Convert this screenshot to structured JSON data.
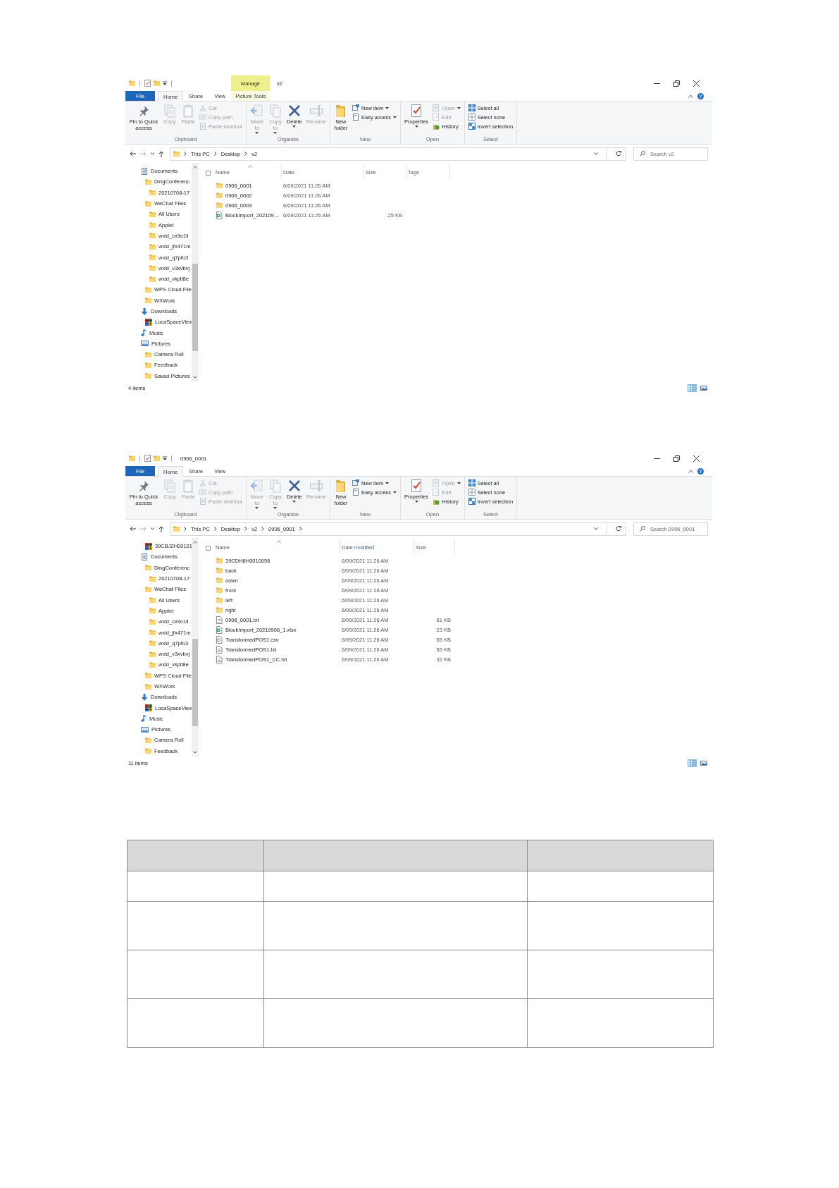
{
  "windows": [
    {
      "title": "v2",
      "context_header": "Manage",
      "help": "?",
      "ribbon_tabs": [
        {
          "label": "File",
          "kind": "file",
          "selected": false
        },
        {
          "label": "Home",
          "kind": "tab",
          "selected": true
        },
        {
          "label": "Share",
          "kind": "tab",
          "selected": false
        },
        {
          "label": "View",
          "kind": "tab",
          "selected": false
        },
        {
          "label": "Picture Tools",
          "kind": "context",
          "selected": false
        }
      ],
      "ribbon_groups": [
        {
          "label": "Clipboard",
          "commands": [
            {
              "label": "Pin to Quick access",
              "kind": "large",
              "disabled": false,
              "menu": false
            },
            {
              "label": "Copy",
              "kind": "large",
              "disabled": true,
              "menu": false
            },
            {
              "label": "Paste",
              "kind": "large",
              "disabled": true,
              "menu": false
            },
            {
              "label": "Cut",
              "kind": "small",
              "disabled": true,
              "menu": false
            },
            {
              "label": "Copy path",
              "kind": "small",
              "disabled": true,
              "menu": false
            },
            {
              "label": "Paste shortcut",
              "kind": "small",
              "disabled": true,
              "menu": false
            }
          ]
        },
        {
          "label": "Organise",
          "commands": [
            {
              "label": "Move to",
              "kind": "large",
              "disabled": true,
              "menu": true
            },
            {
              "label": "Copy to",
              "kind": "large",
              "disabled": true,
              "menu": true
            },
            {
              "label": "Delete",
              "kind": "large",
              "disabled": false,
              "menu": true
            },
            {
              "label": "Rename",
              "kind": "large",
              "disabled": true,
              "menu": false
            }
          ]
        },
        {
          "label": "New",
          "commands": [
            {
              "label": "New folder",
              "kind": "large",
              "disabled": false,
              "menu": false
            },
            {
              "label": "New item",
              "kind": "small",
              "disabled": false,
              "menu": true
            },
            {
              "label": "Easy access",
              "kind": "small",
              "disabled": false,
              "menu": true
            }
          ]
        },
        {
          "label": "Open",
          "commands": [
            {
              "label": "Properties",
              "kind": "large",
              "disabled": false,
              "menu": true
            },
            {
              "label": "Open",
              "kind": "small",
              "disabled": true,
              "menu": true
            },
            {
              "label": "Edit",
              "kind": "small",
              "disabled": true,
              "menu": false
            },
            {
              "label": "History",
              "kind": "small",
              "disabled": false,
              "menu": false
            }
          ]
        },
        {
          "label": "Select",
          "commands": [
            {
              "label": "Select all",
              "kind": "small",
              "disabled": false,
              "menu": false
            },
            {
              "label": "Select none",
              "kind": "small",
              "disabled": false,
              "menu": false
            },
            {
              "label": "Invert selection",
              "kind": "small",
              "disabled": false,
              "menu": false
            }
          ]
        }
      ],
      "address": {
        "crumbs": [
          "This PC",
          "Desktop",
          "v2"
        ],
        "trailing_chevron": false
      },
      "search": {
        "placeholder": "Search v2"
      },
      "nav": [
        {
          "label": "Documents",
          "kind": "documents",
          "children": [
            {
              "label": "DingConferenc",
              "kind": "folder",
              "children": [
                {
                  "label": "20210708-17",
                  "kind": "folder"
                }
              ]
            },
            {
              "label": "WeChat Files",
              "kind": "folder",
              "children": [
                {
                  "label": "All Users",
                  "kind": "folder"
                },
                {
                  "label": "Applet",
                  "kind": "folder"
                },
                {
                  "label": "wxid_cx9o1il",
                  "kind": "folder"
                },
                {
                  "label": "wxid_jfx471m",
                  "kind": "folder"
                },
                {
                  "label": "wxid_q7pfo3",
                  "kind": "folder"
                },
                {
                  "label": "wxid_v3xvbvj",
                  "kind": "folder"
                },
                {
                  "label": "wxid_vkplt8e",
                  "kind": "folder"
                }
              ]
            },
            {
              "label": "WPS Cloud File",
              "kind": "folder"
            },
            {
              "label": "WXWork",
              "kind": "folder"
            }
          ]
        },
        {
          "label": "Downloads",
          "kind": "downloads",
          "children": [
            {
              "label": "LocaSpaceView",
              "kind": "app"
            }
          ]
        },
        {
          "label": "Music",
          "kind": "music"
        },
        {
          "label": "Pictures",
          "kind": "pictures",
          "children": [
            {
              "label": "Camera Roll",
              "kind": "folder"
            },
            {
              "label": "Feedback",
              "kind": "folder"
            },
            {
              "label": "Saved Pictures",
              "kind": "folder"
            }
          ]
        }
      ],
      "select_all": {
        "checked": false
      },
      "columns": [
        {
          "label": "Name",
          "sorted": true
        },
        {
          "label": "Date",
          "sorted": false
        },
        {
          "label": "Size",
          "sorted": false
        },
        {
          "label": "Tags",
          "sorted": false
        }
      ],
      "files": [
        {
          "name": "0906_0001",
          "kind": "folder",
          "date": "6/09/2021 11:26 AM"
        },
        {
          "name": "0906_0002",
          "kind": "folder",
          "date": "6/09/2021 11:26 AM"
        },
        {
          "name": "0906_0003",
          "kind": "folder",
          "date": "6/09/2021 11:26 AM"
        },
        {
          "name": "BlockImport_202109…",
          "kind": "excel",
          "date": "6/09/2021 11:26 AM",
          "size": "25 KB"
        }
      ],
      "status": "4 items",
      "view_buttons": [
        {
          "selected": true
        },
        {
          "selected": false
        }
      ]
    },
    {
      "title": "0906_0001",
      "help": "?",
      "ribbon_tabs": [
        {
          "label": "File",
          "kind": "file",
          "selected": false
        },
        {
          "label": "Home",
          "kind": "tab",
          "selected": true
        },
        {
          "label": "Share",
          "kind": "tab",
          "selected": false
        },
        {
          "label": "View",
          "kind": "tab",
          "selected": false
        }
      ],
      "ribbon_groups": [
        {
          "label": "Clipboard",
          "commands": [
            {
              "label": "Pin to Quick access",
              "kind": "large",
              "disabled": false,
              "menu": false
            },
            {
              "label": "Copy",
              "kind": "large",
              "disabled": true,
              "menu": false
            },
            {
              "label": "Paste",
              "kind": "large",
              "disabled": true,
              "menu": false
            },
            {
              "label": "Cut",
              "kind": "small",
              "disabled": true,
              "menu": false
            },
            {
              "label": "Copy path",
              "kind": "small",
              "disabled": true,
              "menu": false
            },
            {
              "label": "Paste shortcut",
              "kind": "small",
              "disabled": true,
              "menu": false
            }
          ]
        },
        {
          "label": "Organise",
          "commands": [
            {
              "label": "Move to",
              "kind": "large",
              "disabled": true,
              "menu": true
            },
            {
              "label": "Copy to",
              "kind": "large",
              "disabled": true,
              "menu": true
            },
            {
              "label": "Delete",
              "kind": "large",
              "disabled": false,
              "menu": true
            },
            {
              "label": "Rename",
              "kind": "large",
              "disabled": true,
              "menu": false
            }
          ]
        },
        {
          "label": "New",
          "commands": [
            {
              "label": "New folder",
              "kind": "large",
              "disabled": false,
              "menu": false
            },
            {
              "label": "New item",
              "kind": "small",
              "disabled": false,
              "menu": true
            },
            {
              "label": "Easy access",
              "kind": "small",
              "disabled": false,
              "menu": true
            }
          ]
        },
        {
          "label": "Open",
          "commands": [
            {
              "label": "Properties",
              "kind": "large",
              "disabled": false,
              "menu": true
            },
            {
              "label": "Open",
              "kind": "small",
              "disabled": true,
              "menu": true
            },
            {
              "label": "Edit",
              "kind": "small",
              "disabled": true,
              "menu": false
            },
            {
              "label": "History",
              "kind": "small",
              "disabled": false,
              "menu": false
            }
          ]
        },
        {
          "label": "Select",
          "commands": [
            {
              "label": "Select all",
              "kind": "small",
              "disabled": false,
              "menu": false
            },
            {
              "label": "Select none",
              "kind": "small",
              "disabled": false,
              "menu": false
            },
            {
              "label": "Invert selection",
              "kind": "small",
              "disabled": false,
              "menu": false
            }
          ]
        }
      ],
      "address": {
        "crumbs": [
          "This PC",
          "Desktop",
          "v2",
          "0906_0001"
        ],
        "trailing_chevron": true
      },
      "search": {
        "placeholder": "Search 0906_0001"
      },
      "nav": [
        {
          "children": [
            {
              "label": "39CBJ2H00101",
              "kind": "app"
            }
          ]
        },
        {
          "label": "Documents",
          "kind": "documents",
          "children": [
            {
              "label": "DingConferenc",
              "kind": "folder",
              "children": [
                {
                  "label": "20210708-17",
                  "kind": "folder"
                }
              ]
            },
            {
              "label": "WeChat Files",
              "kind": "folder",
              "children": [
                {
                  "label": "All Users",
                  "kind": "folder"
                },
                {
                  "label": "Applet",
                  "kind": "folder"
                },
                {
                  "label": "wxid_cx9o1il",
                  "kind": "folder"
                },
                {
                  "label": "wxid_jfx471m",
                  "kind": "folder"
                },
                {
                  "label": "wxid_q7pfo3",
                  "kind": "folder"
                },
                {
                  "label": "wxid_v3xvbvj",
                  "kind": "folder"
                },
                {
                  "label": "wxid_vkplt8e",
                  "kind": "folder"
                }
              ]
            },
            {
              "label": "WPS Cloud File",
              "kind": "folder"
            },
            {
              "label": "WXWork",
              "kind": "folder"
            }
          ]
        },
        {
          "label": "Downloads",
          "kind": "downloads",
          "children": [
            {
              "label": "LocaSpaceView",
              "kind": "app"
            }
          ]
        },
        {
          "label": "Music",
          "kind": "music"
        },
        {
          "label": "Pictures",
          "kind": "pictures",
          "children": [
            {
              "label": "Camera Roll",
              "kind": "folder"
            },
            {
              "label": "Feedback",
              "kind": "folder"
            }
          ]
        }
      ],
      "select_all": {
        "checked": false
      },
      "columns": [
        {
          "label": "Name",
          "sorted": true
        },
        {
          "label": "Date modified",
          "sorted": false
        },
        {
          "label": "Size",
          "sorted": false
        }
      ],
      "files": [
        {
          "name": "39CDH8H0010056",
          "kind": "folder",
          "date": "6/09/2021 11:26 AM"
        },
        {
          "name": "back",
          "kind": "folder",
          "date": "6/09/2021 11:26 AM"
        },
        {
          "name": "down",
          "kind": "folder",
          "date": "6/09/2021 11:26 AM"
        },
        {
          "name": "front",
          "kind": "folder",
          "date": "6/09/2021 11:26 AM"
        },
        {
          "name": "left",
          "kind": "folder",
          "date": "6/09/2021 11:26 AM"
        },
        {
          "name": "right",
          "kind": "folder",
          "date": "6/09/2021 11:26 AM"
        },
        {
          "name": "0906_0001.txt",
          "kind": "text",
          "date": "6/09/2021 11:26 AM",
          "size": "61 KB"
        },
        {
          "name": "BlockImport_20210906_1.xlsx",
          "kind": "excel",
          "date": "6/09/2021 11:26 AM",
          "size": "23 KB"
        },
        {
          "name": "TransformedPOS1.csv",
          "kind": "csv",
          "date": "6/09/2021 11:26 AM",
          "size": "55 KB"
        },
        {
          "name": "TransformedPOS1.txt",
          "kind": "text",
          "date": "6/09/2021 11:26 AM",
          "size": "55 KB"
        },
        {
          "name": "TransformedPOS1_CC.txt",
          "kind": "text",
          "date": "6/09/2021 11:26 AM",
          "size": "32 KB"
        }
      ],
      "status": "11 items",
      "view_buttons": [
        {
          "selected": true
        },
        {
          "selected": false
        }
      ]
    }
  ],
  "table": {
    "rows": [
      {
        "kind": "header"
      },
      {
        "kind": "short"
      },
      {
        "kind": "tall"
      },
      {
        "kind": "tall"
      },
      {
        "kind": "tall"
      }
    ]
  }
}
